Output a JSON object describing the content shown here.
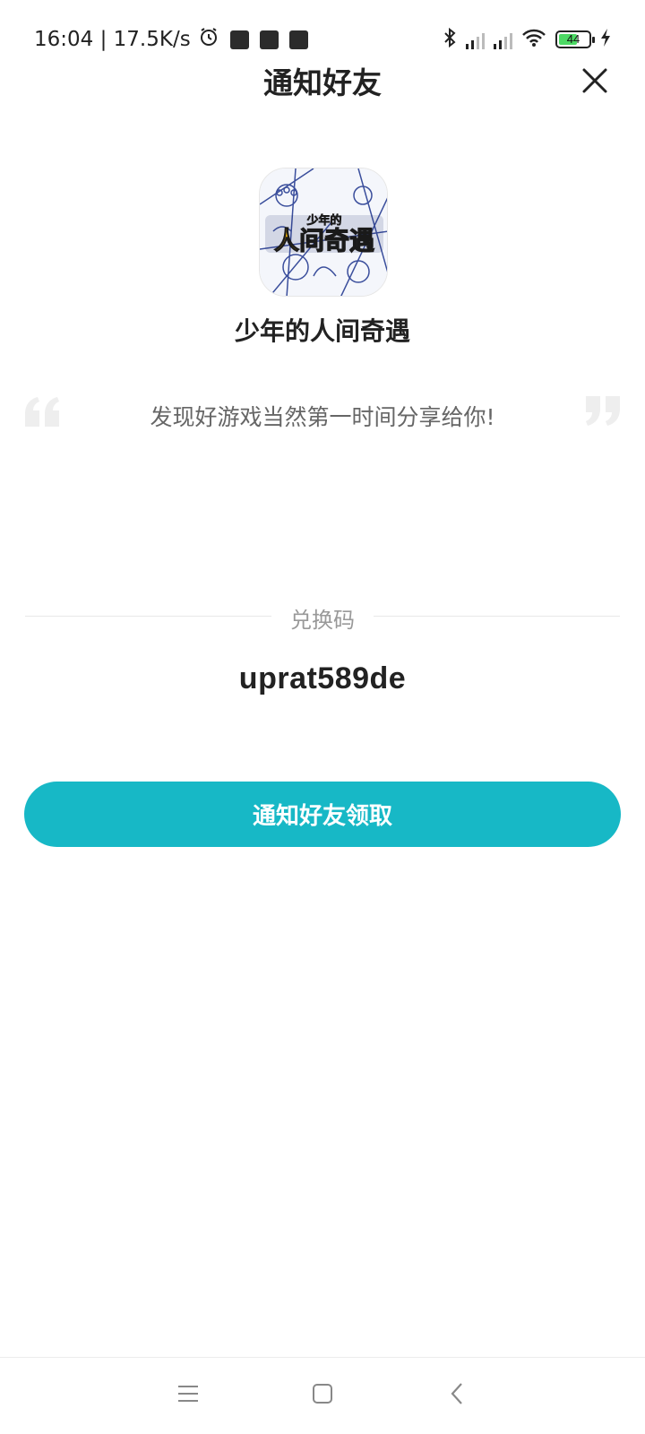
{
  "status_bar": {
    "time_speed": "16:04 | 17.5K/s",
    "battery_level": "44",
    "icons": [
      "alarm-icon",
      "notification-icon",
      "notification-icon",
      "notification-icon",
      "bluetooth-icon",
      "signal-icon",
      "signal-icon",
      "wifi-icon",
      "battery-icon",
      "charging-icon"
    ]
  },
  "header": {
    "title": "通知好友",
    "close_icon": "close-icon"
  },
  "app": {
    "name": "少年的人间奇遇",
    "icon_text_top": "少年的",
    "icon_text_main": "人间奇遇"
  },
  "slogan": "发现好游戏当然第一时间分享给你!",
  "redeem": {
    "label": "兑换码",
    "code": "uprat589de"
  },
  "notify_button": {
    "label": "通知好友领取",
    "color": "#17b8c6"
  },
  "nav_bar": {
    "items": [
      "menu-icon",
      "home-icon",
      "back-icon"
    ]
  }
}
